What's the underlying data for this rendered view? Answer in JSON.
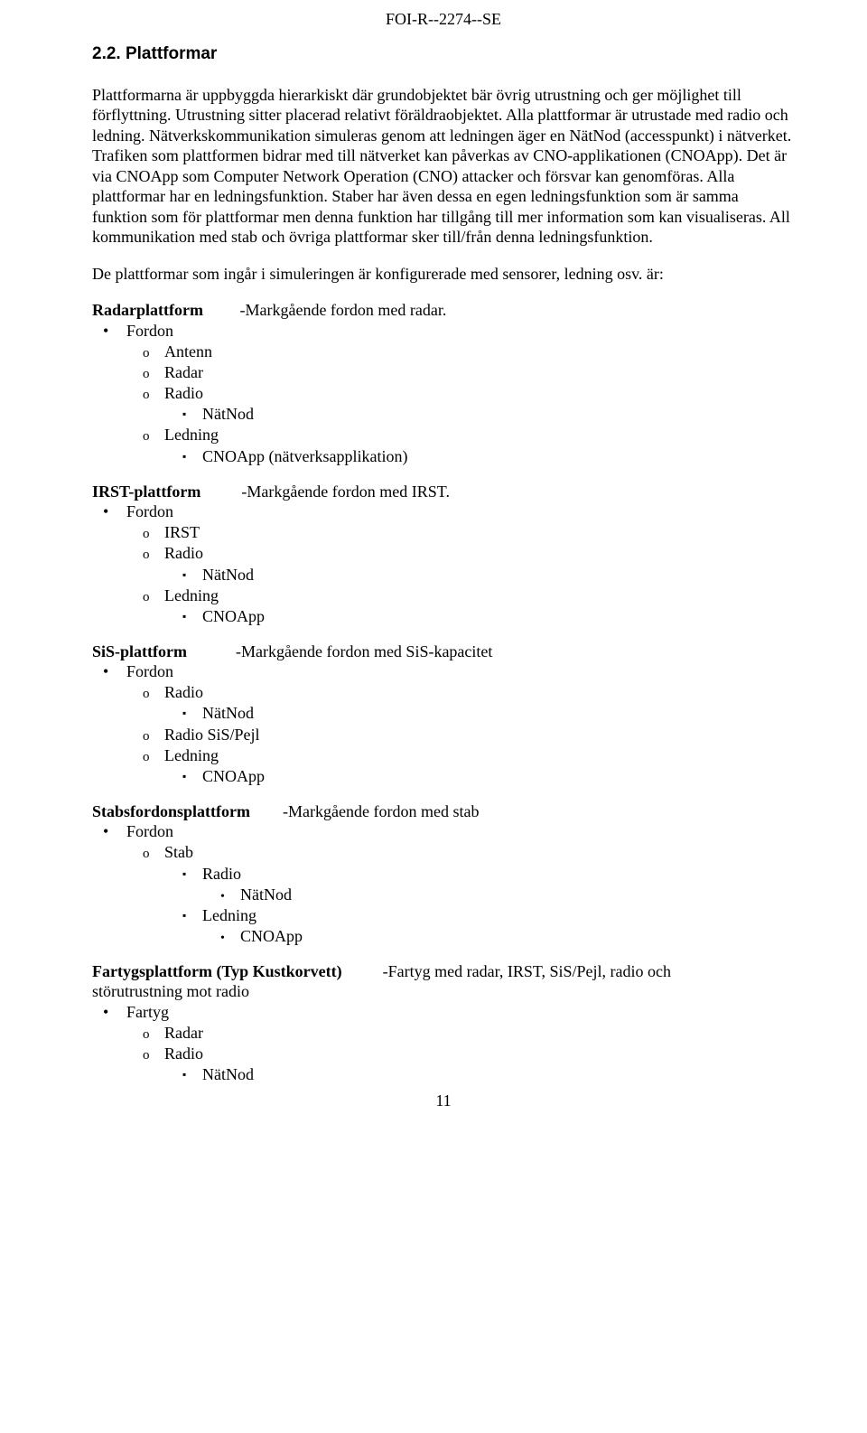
{
  "doc_code": "FOI-R--2274--SE",
  "section_heading": "2.2.  Plattformar",
  "para1": "Plattformarna är uppbyggda hierarkiskt där grundobjektet bär övrig utrustning och ger möjlighet till förflyttning. Utrustning sitter placerad relativt föräldraobjektet. Alla plattformar är utrustade med radio och ledning. Nätverkskommunikation simuleras genom att ledningen äger en NätNod (accesspunkt) i nätverket. Trafiken som plattformen bidrar med till nätverket kan påverkas av CNO-applikationen (CNOApp). Det är via CNOApp som Computer Network Operation (CNO) attacker och försvar kan genomföras. Alla plattformar har en ledningsfunktion. Staber har även dessa en egen ledningsfunktion som är samma funktion som för plattformar men denna funktion har tillgång till mer information som kan visualiseras. All kommunikation med stab och övriga plattformar sker till/från denna ledningsfunktion.",
  "para2": "De plattformar som ingår i simuleringen är konfigurerade med sensorer, ledning osv. är:",
  "platforms": {
    "radar": {
      "name": "Radarplattform",
      "desc": "-Markgående fordon med radar.",
      "top": "Fordon",
      "items": [
        "Antenn",
        "Radar",
        "Radio",
        "Ledning"
      ],
      "radio_sub": "NätNod",
      "ledning_sub": "CNOApp (nätverksapplikation)"
    },
    "irst": {
      "name": "IRST-plattform",
      "desc": "-Markgående fordon med IRST.",
      "top": "Fordon",
      "items": [
        "IRST",
        "Radio",
        "Ledning"
      ],
      "radio_sub": "NätNod",
      "ledning_sub": "CNOApp"
    },
    "sis": {
      "name": "SiS-plattform",
      "desc": "-Markgående fordon med SiS-kapacitet",
      "top": "Fordon",
      "items": [
        "Radio",
        "Radio SiS/Pejl",
        "Ledning"
      ],
      "radio_sub": "NätNod",
      "ledning_sub": "CNOApp"
    },
    "stab": {
      "name": "Stabsfordonsplattform",
      "desc": "-Markgående fordon med stab",
      "top": "Fordon",
      "items": [
        "Stab"
      ],
      "stab_subs": [
        "Radio",
        "Ledning"
      ],
      "radio_sub": "NätNod",
      "ledning_sub": "CNOApp"
    },
    "fartyg": {
      "name": "Fartygsplattform (Typ Kustkorvett)",
      "desc": "-Fartyg med radar, IRST, SiS/Pejl, radio och",
      "line2": "störutrustning mot radio",
      "top": "Fartyg",
      "items": [
        "Radar",
        "Radio"
      ],
      "radio_sub": "NätNod"
    }
  },
  "page_number": "11"
}
